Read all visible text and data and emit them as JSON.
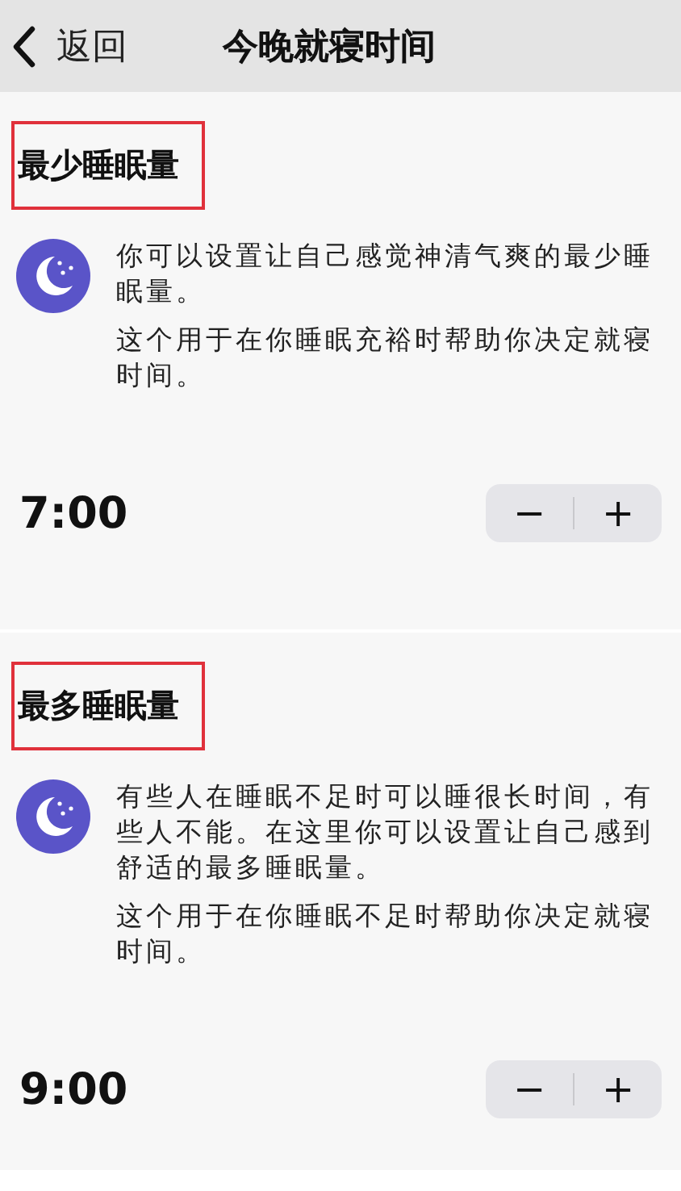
{
  "nav": {
    "back": "返回",
    "title": "今晚就寝时间"
  },
  "sections": [
    {
      "heading": "最少睡眠量",
      "highlighted": true,
      "paragraphs": [
        "你可以设置让自己感觉神清气爽的最少睡眠量。",
        "这个用于在你睡眠充裕时帮助你决定就寝时间。"
      ],
      "value": "7:00",
      "minus": "−",
      "plus": "+"
    },
    {
      "heading": "最多睡眠量",
      "highlighted": true,
      "paragraphs": [
        "有些人在睡眠不足时可以睡很长时间，有些人不能。在这里你可以设置让自己感到舒适的最多睡眠量。",
        "这个用于在你睡眠不足时帮助你决定就寝时间。"
      ],
      "value": "9:00",
      "minus": "−",
      "plus": "+"
    }
  ]
}
